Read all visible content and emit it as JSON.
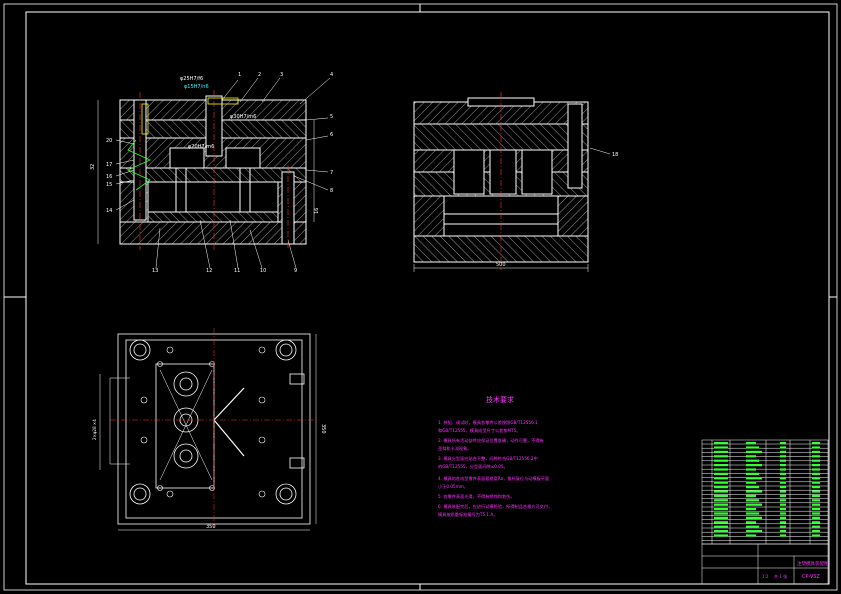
{
  "colors": {
    "background": "#000000",
    "line": "#ffffff",
    "hatch": "#ffffff",
    "centerline": "#ff3333",
    "accent": "#ff33ff",
    "highlight": "#ffff00",
    "green": "#33ff33",
    "cyan": "#33ffff",
    "title_block": "#ffffff"
  },
  "section_view": {
    "fit_labels": [
      "φ25H7/f6",
      "φ15H7/n6",
      "φ30H7/m6",
      "φ20H7/m6"
    ],
    "balloons_top": [
      "1",
      "2",
      "3",
      "4"
    ],
    "balloons_right": [
      "5",
      "6",
      "7",
      "8"
    ],
    "balloons_bottom": [
      "13",
      "12",
      "11",
      "10",
      "9"
    ],
    "balloons_left": [
      "20",
      "17",
      "16",
      "15",
      "14"
    ],
    "side_dims": [
      "32",
      "16"
    ]
  },
  "side_view": {
    "balloon": "18",
    "dim_width": "500"
  },
  "plan_view": {
    "dim_bottom": "350",
    "dim_right": "350",
    "dim_left": "2×φ28 ×4"
  },
  "tech_requirements": {
    "title": "技术要求",
    "lines": [
      "1. 装配、调试时，模具各零件公差按照GB/T12556.1",
      "   和GB/T12555，模具成型尺寸公差按MT5。",
      "2. 模具所有活动部件应保证位置准确，动作可靠，不得有",
      "   歪斜和卡滞现象。",
      "3. 模具分型面应贴合平整，间隙符合GB/T12556.2中",
      "   的GB/T12555，分型面间隙≤0.05。",
      "4. 模具的各成型零件表面粗糙度Ra，推杆复位与动模板平面",
      "   小于0.05mm。",
      "5. 各零件表面光滑，不得有锈蚀和划伤。",
      "6. 模具装配完后，应进行试模检验，所得制品合格方可交付，",
      "   模具按质量标准编号为T5.1.A。"
    ]
  },
  "title_block": {
    "drawing_name": "注塑模具装配图",
    "code": "CP-VSZ",
    "scale": "1:2",
    "sheet": "共 1 张"
  }
}
